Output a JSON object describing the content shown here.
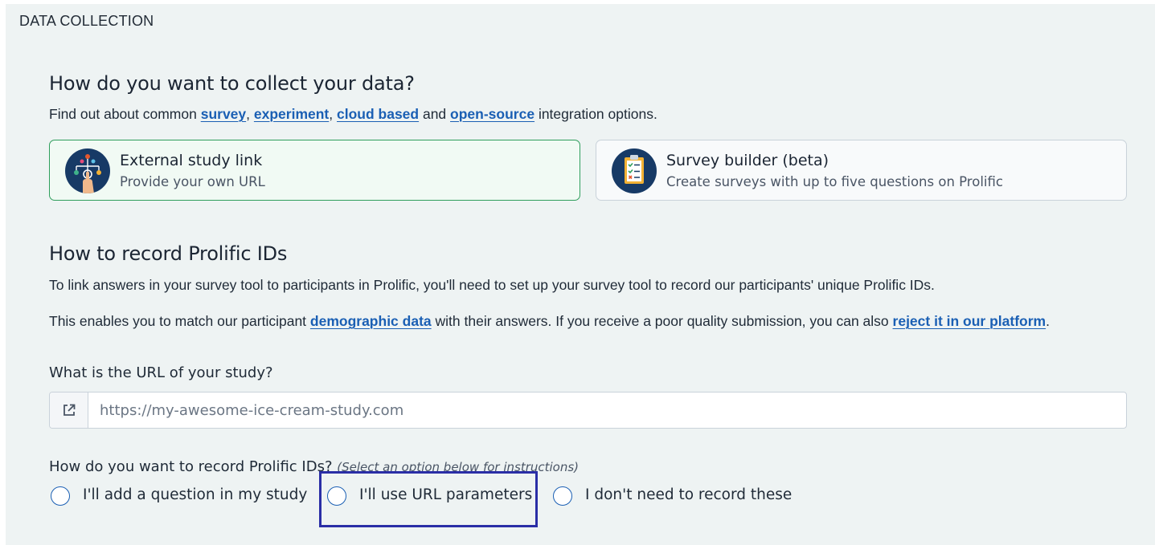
{
  "section": {
    "label": "DATA COLLECTION"
  },
  "collect": {
    "heading": "How do you want to collect your data?",
    "intro_pre": "Find out about common ",
    "links": [
      "survey",
      "experiment",
      "cloud based",
      "open-source"
    ],
    "sep1": ", ",
    "sep2": ", ",
    "sep3": " and ",
    "intro_post": " integration options.",
    "options": [
      {
        "title": "External study link",
        "subtitle": "Provide your own URL",
        "icon": "flowchart-hand-icon",
        "selected": true
      },
      {
        "title": "Survey builder (beta)",
        "subtitle": "Create surveys with up to five questions on Prolific",
        "icon": "clipboard-checklist-icon",
        "selected": false
      }
    ]
  },
  "record": {
    "heading": "How to record Prolific IDs",
    "para1": "To link answers in your survey tool to participants in Prolific, you'll need to set up your survey tool to record our participants' unique Prolific IDs.",
    "para2_pre": "This enables you to match our participant ",
    "para2_link1": "demographic data",
    "para2_mid": " with their answers. If you receive a poor quality submission, you can also ",
    "para2_link2": "reject it in our platform",
    "para2_post": "."
  },
  "url": {
    "label": "What is the URL of your study?",
    "placeholder": "https://my-awesome-ice-cream-study.com",
    "icon": "external-link-icon"
  },
  "method": {
    "label": "How do you want to record Prolific IDs?",
    "hint": "(Select an option below for instructions)",
    "options": [
      "I'll add a question in my study",
      "I'll use URL parameters",
      "I don't need to record these"
    ]
  },
  "colors": {
    "accent": "#1a5fb4",
    "selected_border": "#2f9e5c",
    "highlight": "#2a2ea6",
    "icon_bg": "#173a66"
  }
}
